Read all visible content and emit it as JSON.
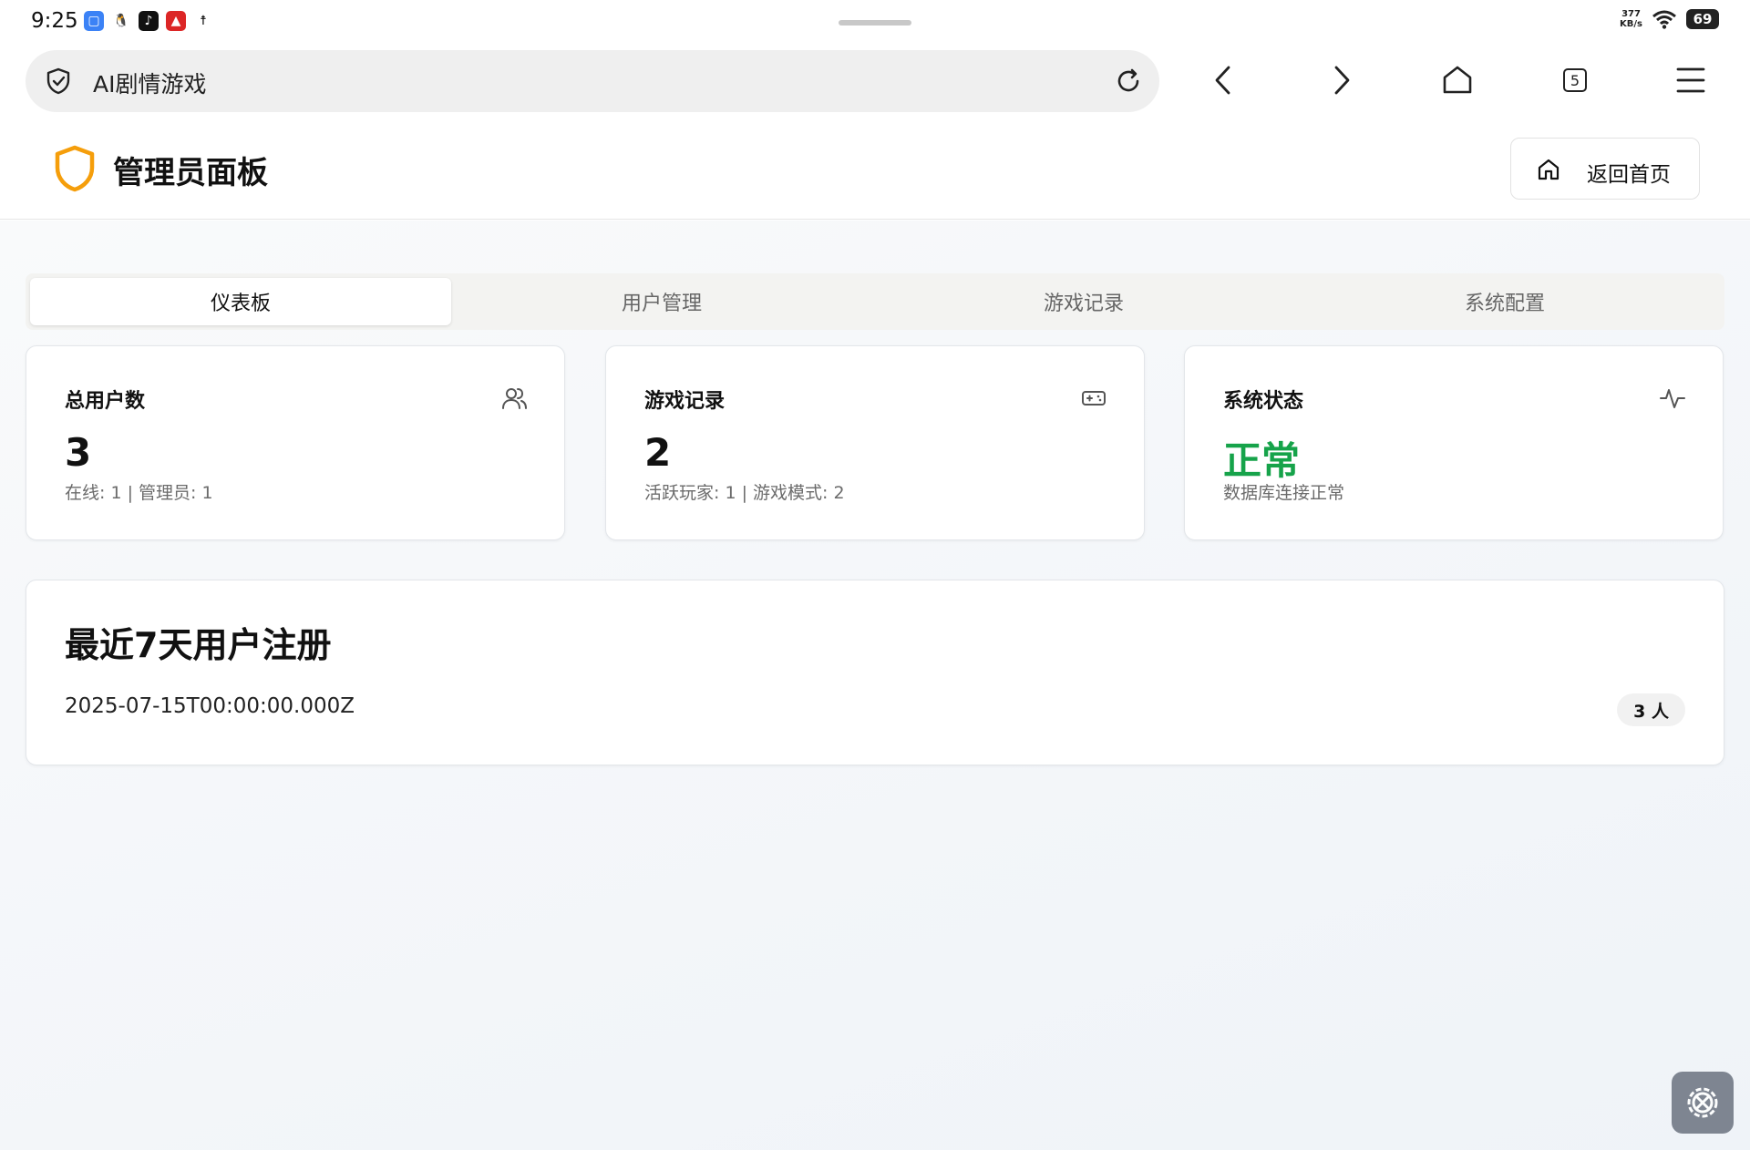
{
  "status_bar": {
    "time": "9:25",
    "net_speed_value": "377",
    "net_speed_unit": "KB/s",
    "battery": "69",
    "app_icons": [
      "messages-icon",
      "qq-icon",
      "tiktok-icon",
      "app-icon",
      "accessibility-icon"
    ]
  },
  "browser": {
    "url_text": "AI剧情游戏",
    "tab_count": "5"
  },
  "header": {
    "title": "管理员面板",
    "home_button": "返回首页",
    "accent_color": "#f59e0b"
  },
  "tabs": [
    {
      "label": "仪表板",
      "active": true
    },
    {
      "label": "用户管理",
      "active": false
    },
    {
      "label": "游戏记录",
      "active": false
    },
    {
      "label": "系统配置",
      "active": false
    }
  ],
  "stats": {
    "users": {
      "title": "总用户数",
      "value": "3",
      "sub": "在线: 1 | 管理员: 1",
      "icon": "users-icon"
    },
    "games": {
      "title": "游戏记录",
      "value": "2",
      "sub": "活跃玩家: 1 | 游戏模式: 2",
      "icon": "gamepad-icon"
    },
    "system": {
      "title": "系统状态",
      "value": "正常",
      "sub": "数据库连接正常",
      "icon": "activity-icon",
      "value_color": "#16a34a"
    }
  },
  "registrations": {
    "title": "最近7天用户注册",
    "rows": [
      {
        "date": "2025-07-15T00:00:00.000Z",
        "count": "3 人"
      }
    ]
  }
}
